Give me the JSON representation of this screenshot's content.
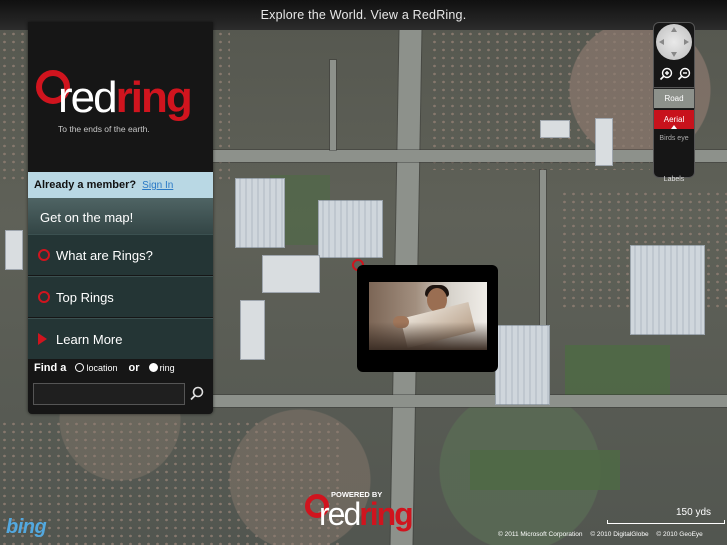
{
  "header": {
    "tagline": "Explore the World. View a RedRing."
  },
  "brand": {
    "name_part1": "red",
    "name_part2": "ring",
    "slogan": "To the ends of the earth."
  },
  "member": {
    "prompt": "Already a member?",
    "signin_label": "Sign In"
  },
  "cta": {
    "get_on_map": "Get on the map!"
  },
  "menu": [
    {
      "label": "What are Rings?",
      "icon": "ring-icon"
    },
    {
      "label": "Top Rings",
      "icon": "ring-icon"
    },
    {
      "label": "Learn More",
      "icon": "play-arrow-icon"
    }
  ],
  "find": {
    "label": "Find a",
    "option_location": "location",
    "or_label": "or",
    "option_ring": "ring",
    "selected": "ring",
    "search_value": ""
  },
  "map_controls": {
    "road_label": "Road",
    "aerial_label": "Aerial",
    "birds_eye_label": "Birds eye",
    "labels_label": "Labels",
    "active_mode": "Aerial"
  },
  "footer": {
    "bing_logo": "bing",
    "powered_by": "POWERED BY",
    "scale": "150 yds",
    "credits": [
      "© 2011 Microsoft Corporation",
      "© 2010 DigitalGlobe",
      "© 2010 GeoEye"
    ]
  },
  "colors": {
    "brand_red": "#d0141e",
    "member_bar": "#b9d8e4",
    "panel_dark": "#161616",
    "menu_teal": "#243535"
  }
}
